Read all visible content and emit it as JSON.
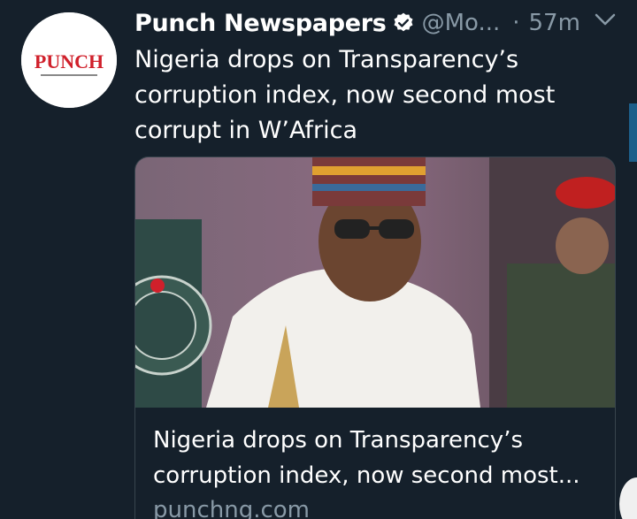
{
  "tweet": {
    "author": {
      "display_name": "Punch Newspapers",
      "handle": "@Mo...",
      "verified": true,
      "avatar_logo_text": "PUNCH"
    },
    "separator": "·",
    "timestamp": "57m",
    "text": "Nigeria drops on Transparency’s corruption index, now second most corrupt in W’Africa",
    "card": {
      "title": "Nigeria drops on Transparency’s corruption index, now second most...",
      "domain": "punchng.com"
    }
  },
  "icons": {
    "verified": "verified-badge-icon",
    "more": "chevron-down-icon"
  },
  "colors": {
    "background": "#15202b",
    "primary_text": "#ffffff",
    "secondary_text": "#8899a6",
    "card_border": "#38444d",
    "punch_red": "#d0202b"
  }
}
